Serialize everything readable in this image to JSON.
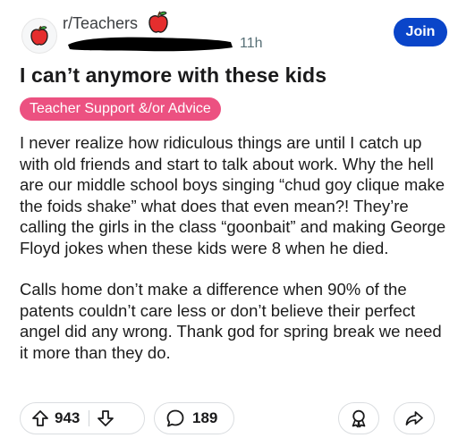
{
  "header": {
    "subreddit": "r/Teachers",
    "time": "11h",
    "join_label": "Join"
  },
  "post": {
    "title": "I can’t anymore with these kids",
    "flair": "Teacher Support &/or Advice",
    "paragraphs": [
      "I never realize how ridiculous things are until I catch up with old friends and start to talk about work. Why the hell are our middle school boys singing “chud goy clique make the foids shake” what does that even mean?! They’re calling the girls in the class “goonbait” and making George Floyd jokes when these kids were 8 when he died.",
      "Calls home don’t make a difference when 90% of the patents couldn’t care less or don’t believe their perfect angel did any wrong. Thank god for spring break we need it more than they do."
    ]
  },
  "actions": {
    "upvotes": "943",
    "comments": "189"
  },
  "colors": {
    "join_bg": "#0a45c9",
    "flair_bg": "#ec5181"
  },
  "icons": {
    "avatar": "apple-icon",
    "upvote": "arrow-up-icon",
    "downvote": "arrow-down-icon",
    "comment": "speech-bubble-icon",
    "award": "award-icon",
    "share": "share-icon"
  }
}
